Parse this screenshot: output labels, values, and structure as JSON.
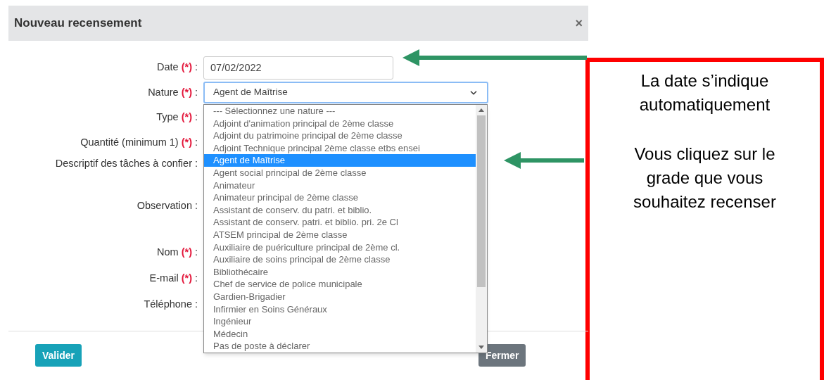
{
  "dialog": {
    "title": "Nouveau recensement",
    "close": "×",
    "fields": [
      {
        "kind": "input",
        "label": "Date",
        "required_mark": "(*)",
        "separator": ":",
        "value": "07/02/2022"
      },
      {
        "kind": "select",
        "label": "Nature",
        "required_mark": "(*)",
        "separator": ":",
        "value": "Agent de Maîtrise"
      },
      {
        "kind": "covered",
        "label": "Type",
        "required_mark": "(*)",
        "separator": ":"
      },
      {
        "kind": "covered",
        "label": "Quantité (minimum 1)",
        "required_mark": "(*)",
        "separator": ":"
      },
      {
        "kind": "covered",
        "label": "Descriptif des tâches à confier",
        "separator": ":"
      },
      {
        "kind": "covered",
        "label": "Observation",
        "separator": ":"
      },
      {
        "kind": "covered",
        "label": "Nom",
        "required_mark": "(*)",
        "separator": ":"
      },
      {
        "kind": "covered",
        "label": "E-mail",
        "required_mark": "(*)",
        "separator": ":"
      },
      {
        "kind": "covered",
        "label": "Téléphone",
        "separator": ":"
      }
    ],
    "nature_options": [
      {
        "label": "--- Sélectionnez une nature ---",
        "selected": false
      },
      {
        "label": "Adjoint d'animation principal de 2ème classe",
        "selected": false
      },
      {
        "label": "Adjoint du patrimoine principal de 2ème classe",
        "selected": false
      },
      {
        "label": "Adjoint Technique principal 2ème classe etbs ensei",
        "selected": false
      },
      {
        "label": "Agent de Maîtrise",
        "selected": true
      },
      {
        "label": "Agent social principal de 2ème classe",
        "selected": false
      },
      {
        "label": "Animateur",
        "selected": false
      },
      {
        "label": "Animateur principal de 2ème classe",
        "selected": false
      },
      {
        "label": "Assistant de conserv. du patri. et biblio.",
        "selected": false
      },
      {
        "label": "Assistant de conserv. patri. et biblio. pri. 2e Cl",
        "selected": false
      },
      {
        "label": "ATSEM principal de 2ème classe",
        "selected": false
      },
      {
        "label": "Auxiliaire de puériculture principal de 2ème cl.",
        "selected": false
      },
      {
        "label": "Auxiliaire de soins principal de 2ème classe",
        "selected": false
      },
      {
        "label": "Bibliothécaire",
        "selected": false
      },
      {
        "label": "Chef de service de police municipale",
        "selected": false
      },
      {
        "label": "Gardien-Brigadier",
        "selected": false
      },
      {
        "label": "Infirmier en Soins Généraux",
        "selected": false
      },
      {
        "label": "Ingénieur",
        "selected": false
      },
      {
        "label": "Médecin",
        "selected": false
      },
      {
        "label": "Pas de poste à déclarer",
        "selected": false
      }
    ],
    "buttons": [
      {
        "kind": "primary",
        "label": "Valider"
      },
      {
        "kind": "secondary",
        "label": "Fermer"
      }
    ]
  },
  "annotations": [
    {
      "text": "La date s’indique\nautomatiquement"
    },
    {
      "text": "Vous cliquez sur le\ngrade que vous\nsouhaitez recenser"
    }
  ]
}
